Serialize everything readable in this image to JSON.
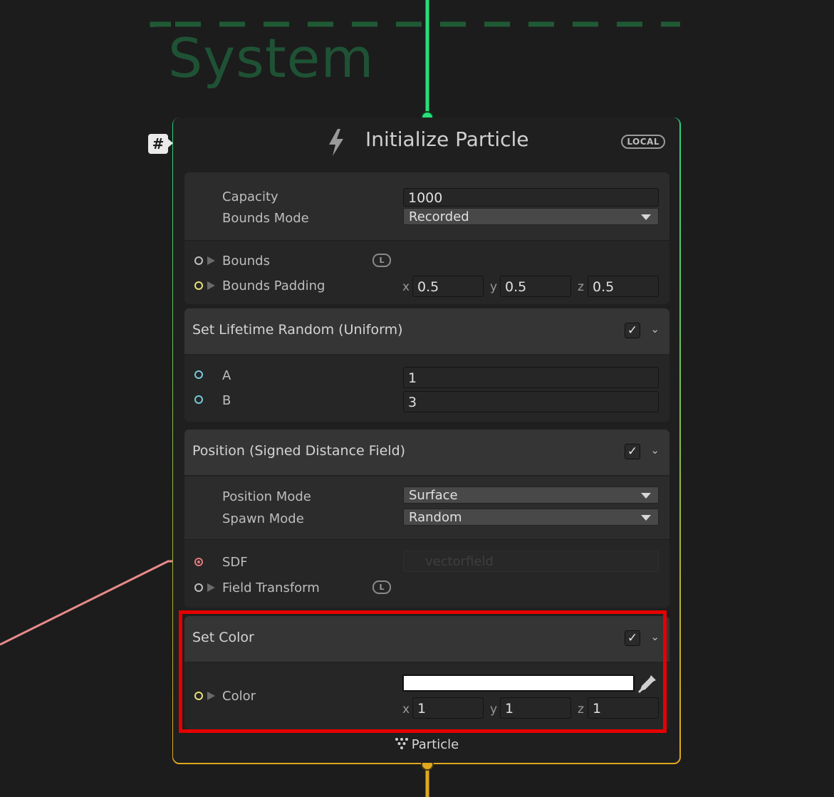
{
  "system": {
    "title": "System"
  },
  "node": {
    "title": "Initialize Particle",
    "space_badge": "LOCAL",
    "group_badge": "#",
    "footer_label": "Particle",
    "colors": {
      "top_edge": "#26e07a",
      "bottom_edge": "#e0a81e",
      "context_border": "#1f5a35"
    }
  },
  "settings": {
    "capacity_label": "Capacity",
    "capacity_value": "1000",
    "bounds_mode_label": "Bounds Mode",
    "bounds_mode_value": "Recorded",
    "bounds_label": "Bounds",
    "bounds_badge": "L",
    "bounds_padding_label": "Bounds Padding",
    "bounds_padding": {
      "x_label": "x",
      "x": "0.5",
      "y_label": "y",
      "y": "0.5",
      "z_label": "z",
      "z": "0.5"
    }
  },
  "lifetime_block": {
    "title": "Set Lifetime Random (Uniform)",
    "a_label": "A",
    "a_value": "1",
    "b_label": "B",
    "b_value": "3"
  },
  "position_block": {
    "title": "Position (Signed Distance Field)",
    "position_mode_label": "Position Mode",
    "position_mode_value": "Surface",
    "spawn_mode_label": "Spawn Mode",
    "spawn_mode_value": "Random",
    "sdf_label": "SDF",
    "sdf_value": "vectorfield",
    "field_transform_label": "Field Transform",
    "field_transform_badge": "L"
  },
  "color_block": {
    "title": "Set Color",
    "color_label": "Color",
    "color_value": "#ffffff",
    "x_label": "x",
    "x": "1",
    "y_label": "y",
    "y": "1",
    "z_label": "z",
    "z": "1"
  },
  "icons": [
    "lightning-icon",
    "checkmark-icon",
    "chevron-down-icon",
    "eyedropper-icon",
    "particle-icon",
    "dropdown-arrow-icon"
  ],
  "highlight_color": "#e60000"
}
